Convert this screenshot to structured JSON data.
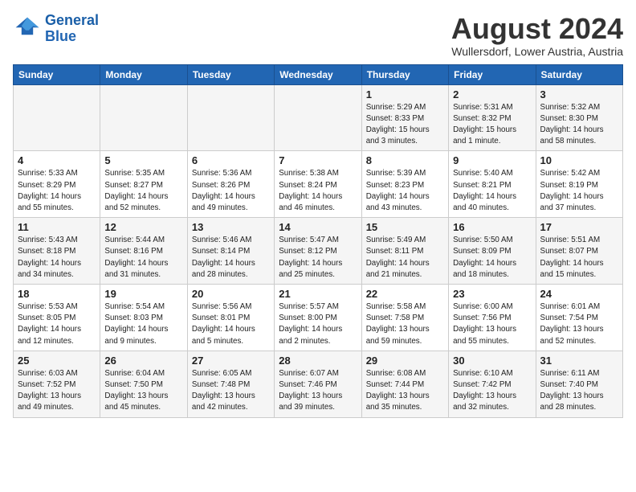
{
  "header": {
    "logo_line1": "General",
    "logo_line2": "Blue",
    "month_year": "August 2024",
    "location": "Wullersdorf, Lower Austria, Austria"
  },
  "weekdays": [
    "Sunday",
    "Monday",
    "Tuesday",
    "Wednesday",
    "Thursday",
    "Friday",
    "Saturday"
  ],
  "weeks": [
    [
      {
        "day": "",
        "info": ""
      },
      {
        "day": "",
        "info": ""
      },
      {
        "day": "",
        "info": ""
      },
      {
        "day": "",
        "info": ""
      },
      {
        "day": "1",
        "info": "Sunrise: 5:29 AM\nSunset: 8:33 PM\nDaylight: 15 hours\nand 3 minutes."
      },
      {
        "day": "2",
        "info": "Sunrise: 5:31 AM\nSunset: 8:32 PM\nDaylight: 15 hours\nand 1 minute."
      },
      {
        "day": "3",
        "info": "Sunrise: 5:32 AM\nSunset: 8:30 PM\nDaylight: 14 hours\nand 58 minutes."
      }
    ],
    [
      {
        "day": "4",
        "info": "Sunrise: 5:33 AM\nSunset: 8:29 PM\nDaylight: 14 hours\nand 55 minutes."
      },
      {
        "day": "5",
        "info": "Sunrise: 5:35 AM\nSunset: 8:27 PM\nDaylight: 14 hours\nand 52 minutes."
      },
      {
        "day": "6",
        "info": "Sunrise: 5:36 AM\nSunset: 8:26 PM\nDaylight: 14 hours\nand 49 minutes."
      },
      {
        "day": "7",
        "info": "Sunrise: 5:38 AM\nSunset: 8:24 PM\nDaylight: 14 hours\nand 46 minutes."
      },
      {
        "day": "8",
        "info": "Sunrise: 5:39 AM\nSunset: 8:23 PM\nDaylight: 14 hours\nand 43 minutes."
      },
      {
        "day": "9",
        "info": "Sunrise: 5:40 AM\nSunset: 8:21 PM\nDaylight: 14 hours\nand 40 minutes."
      },
      {
        "day": "10",
        "info": "Sunrise: 5:42 AM\nSunset: 8:19 PM\nDaylight: 14 hours\nand 37 minutes."
      }
    ],
    [
      {
        "day": "11",
        "info": "Sunrise: 5:43 AM\nSunset: 8:18 PM\nDaylight: 14 hours\nand 34 minutes."
      },
      {
        "day": "12",
        "info": "Sunrise: 5:44 AM\nSunset: 8:16 PM\nDaylight: 14 hours\nand 31 minutes."
      },
      {
        "day": "13",
        "info": "Sunrise: 5:46 AM\nSunset: 8:14 PM\nDaylight: 14 hours\nand 28 minutes."
      },
      {
        "day": "14",
        "info": "Sunrise: 5:47 AM\nSunset: 8:12 PM\nDaylight: 14 hours\nand 25 minutes."
      },
      {
        "day": "15",
        "info": "Sunrise: 5:49 AM\nSunset: 8:11 PM\nDaylight: 14 hours\nand 21 minutes."
      },
      {
        "day": "16",
        "info": "Sunrise: 5:50 AM\nSunset: 8:09 PM\nDaylight: 14 hours\nand 18 minutes."
      },
      {
        "day": "17",
        "info": "Sunrise: 5:51 AM\nSunset: 8:07 PM\nDaylight: 14 hours\nand 15 minutes."
      }
    ],
    [
      {
        "day": "18",
        "info": "Sunrise: 5:53 AM\nSunset: 8:05 PM\nDaylight: 14 hours\nand 12 minutes."
      },
      {
        "day": "19",
        "info": "Sunrise: 5:54 AM\nSunset: 8:03 PM\nDaylight: 14 hours\nand 9 minutes."
      },
      {
        "day": "20",
        "info": "Sunrise: 5:56 AM\nSunset: 8:01 PM\nDaylight: 14 hours\nand 5 minutes."
      },
      {
        "day": "21",
        "info": "Sunrise: 5:57 AM\nSunset: 8:00 PM\nDaylight: 14 hours\nand 2 minutes."
      },
      {
        "day": "22",
        "info": "Sunrise: 5:58 AM\nSunset: 7:58 PM\nDaylight: 13 hours\nand 59 minutes."
      },
      {
        "day": "23",
        "info": "Sunrise: 6:00 AM\nSunset: 7:56 PM\nDaylight: 13 hours\nand 55 minutes."
      },
      {
        "day": "24",
        "info": "Sunrise: 6:01 AM\nSunset: 7:54 PM\nDaylight: 13 hours\nand 52 minutes."
      }
    ],
    [
      {
        "day": "25",
        "info": "Sunrise: 6:03 AM\nSunset: 7:52 PM\nDaylight: 13 hours\nand 49 minutes."
      },
      {
        "day": "26",
        "info": "Sunrise: 6:04 AM\nSunset: 7:50 PM\nDaylight: 13 hours\nand 45 minutes."
      },
      {
        "day": "27",
        "info": "Sunrise: 6:05 AM\nSunset: 7:48 PM\nDaylight: 13 hours\nand 42 minutes."
      },
      {
        "day": "28",
        "info": "Sunrise: 6:07 AM\nSunset: 7:46 PM\nDaylight: 13 hours\nand 39 minutes."
      },
      {
        "day": "29",
        "info": "Sunrise: 6:08 AM\nSunset: 7:44 PM\nDaylight: 13 hours\nand 35 minutes."
      },
      {
        "day": "30",
        "info": "Sunrise: 6:10 AM\nSunset: 7:42 PM\nDaylight: 13 hours\nand 32 minutes."
      },
      {
        "day": "31",
        "info": "Sunrise: 6:11 AM\nSunset: 7:40 PM\nDaylight: 13 hours\nand 28 minutes."
      }
    ]
  ]
}
